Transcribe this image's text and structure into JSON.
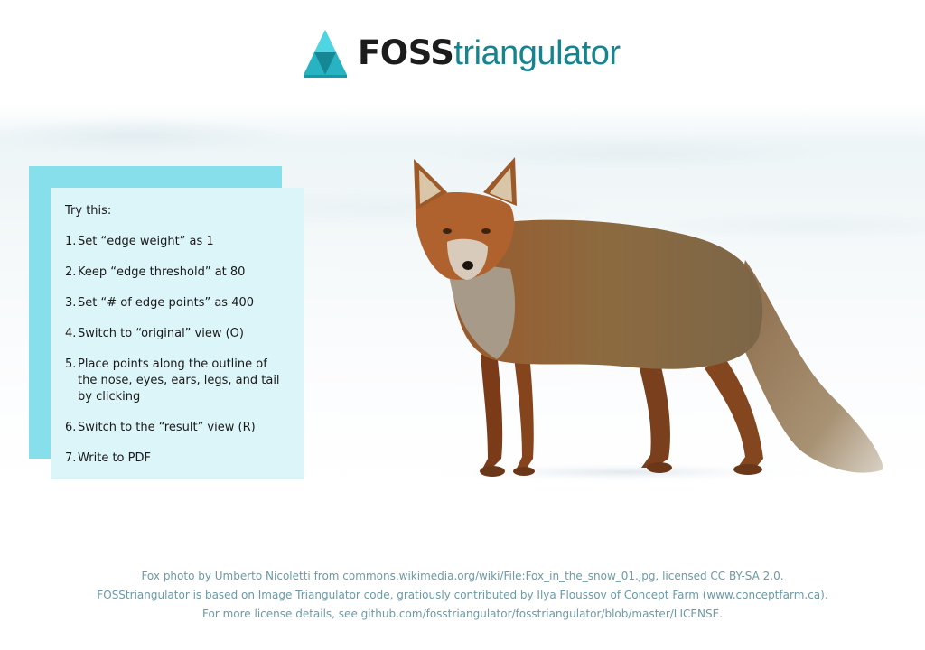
{
  "header": {
    "logo_bold": "FOSS",
    "logo_light": "triangulator",
    "logo_icon": "triangle-logo-icon"
  },
  "instructions": {
    "title": "Try this:",
    "steps": [
      {
        "num": "1.",
        "text": "Set “edge weight” as 1"
      },
      {
        "num": "2.",
        "text": "Keep “edge threshold” at 80"
      },
      {
        "num": "3.",
        "text": "Set “# of edge points” as 400"
      },
      {
        "num": "4.",
        "text": "Switch to “original” view (O)"
      },
      {
        "num": "5.",
        "text": "Place points along the outline of the nose, eyes, ears, legs, and tail by clicking"
      },
      {
        "num": "6.",
        "text": "Switch to the “result” view (R)"
      },
      {
        "num": "7.",
        "text": "Write to PDF"
      }
    ]
  },
  "footer": {
    "line1": "Fox photo by Umberto Nicoletti from commons.wikimedia.org/wiki/File:Fox_in_the_snow_01.jpg, licensed CC BY-SA 2.0.",
    "line2": "FOSStriangulator is based on Image Triangulator code, gratiously contributed by Ilya Floussov of Concept Farm (www.conceptfarm.ca).",
    "line3": "For more license details, see github.com/fosstriangulator/fosstriangulator/blob/master/LICENSE."
  },
  "colors": {
    "accent": "#138490",
    "logo_dark": "#1c1c1c",
    "panel_back": "#86dfea",
    "panel_front": "#dcf5f8",
    "footer_text": "#6a9aa6"
  }
}
